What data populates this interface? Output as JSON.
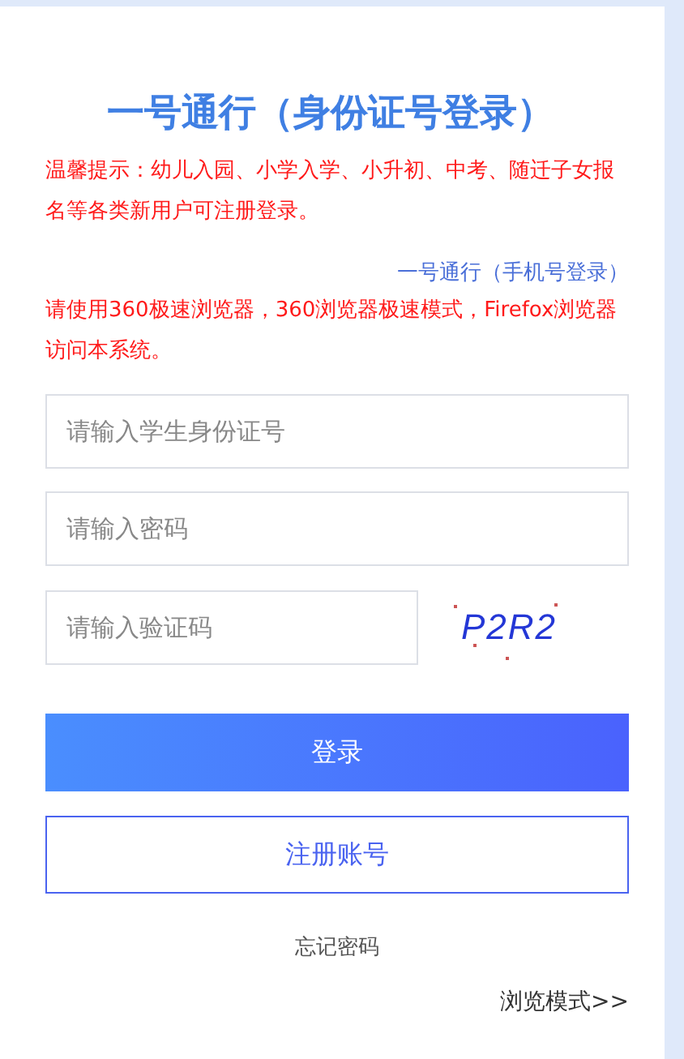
{
  "title": "一号通行（身份证号登录）",
  "notice": "温馨提示：幼儿入园、小学入学、小升初、中考、随迁子女报名等各类新用户可注册登录。",
  "alt_login_link": "一号通行（手机号登录）",
  "browser_notice": "请使用360极速浏览器，360浏览器极速模式，Firefox浏览器访问本系统。",
  "fields": [
    {
      "kind": "text",
      "placeholder": "请输入学生身份证号"
    },
    {
      "kind": "password",
      "placeholder": "请输入密码"
    },
    {
      "kind": "captcha",
      "placeholder": "请输入验证码",
      "captcha_text": "P2R2"
    }
  ],
  "login_button": "登录",
  "register_button": "注册账号",
  "forgot_password": "忘记密码",
  "browse_mode": "浏览模式>>"
}
